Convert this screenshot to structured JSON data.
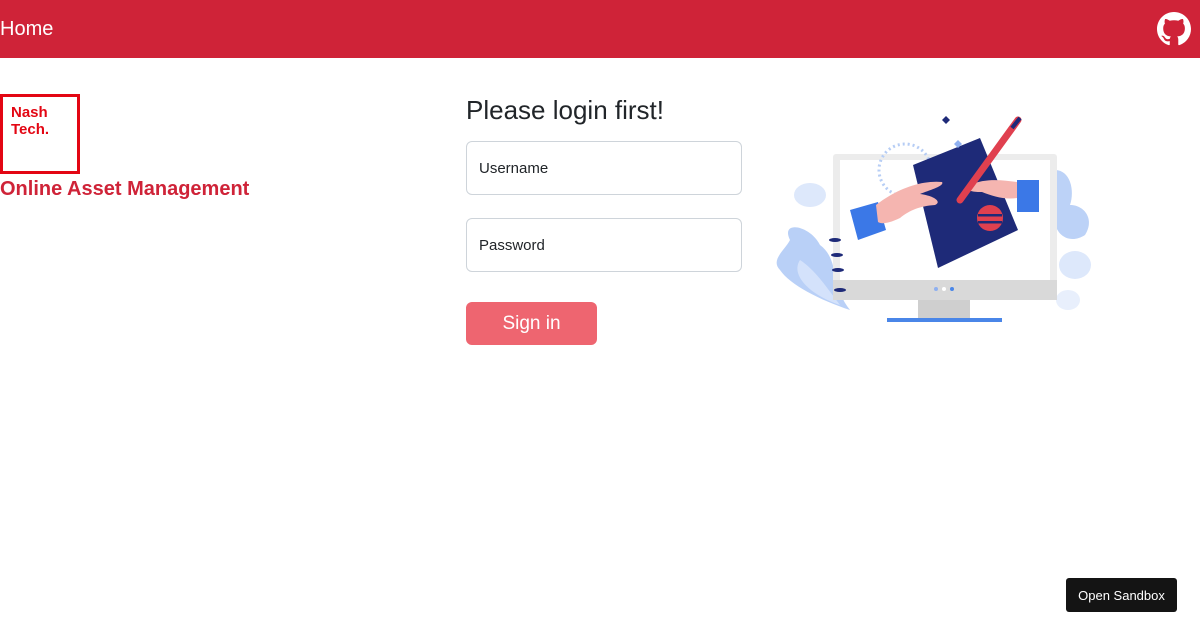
{
  "navbar": {
    "home_label": "Home",
    "github_icon": "github-icon",
    "background_color": "#cf2338"
  },
  "brand": {
    "logo_line1": "Nash",
    "logo_line2": "Tech.",
    "title": "Online Asset Management",
    "color": "#cf2338"
  },
  "login": {
    "title": "Please login first!",
    "username_placeholder": "Username",
    "password_placeholder": "Password",
    "signin_label": "Sign in",
    "button_color": "#ee6570"
  },
  "illustration": {
    "icon": "computer-signing-illustration"
  },
  "sandbox": {
    "label": "Open Sandbox"
  }
}
